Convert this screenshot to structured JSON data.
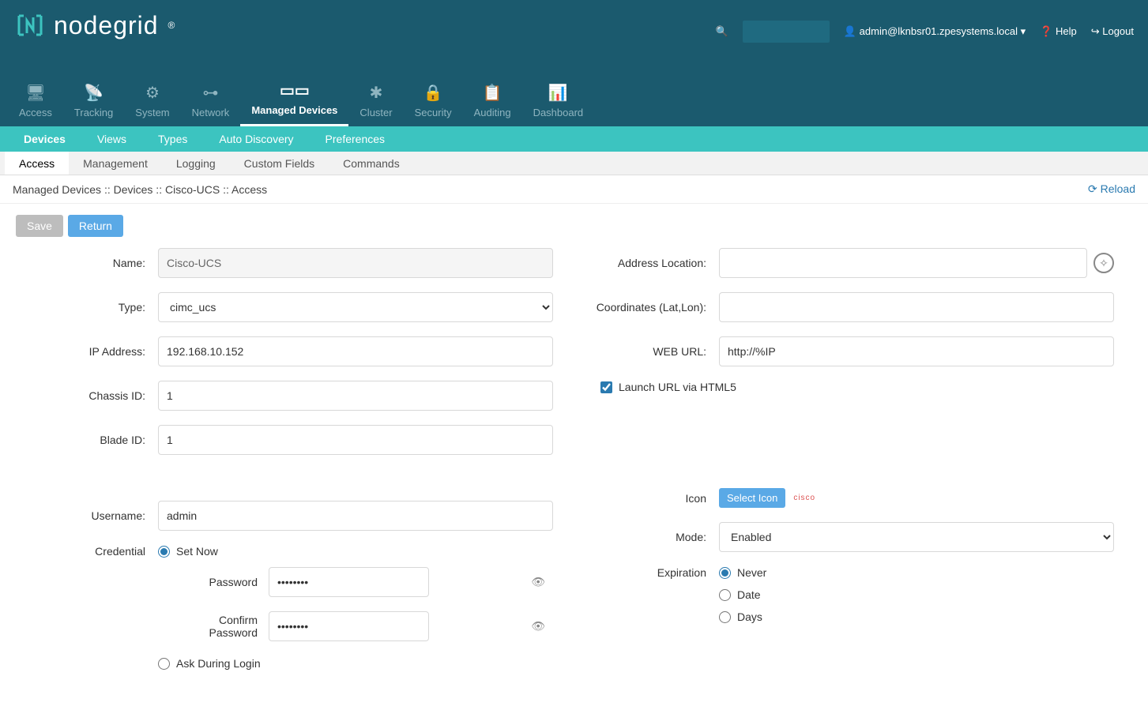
{
  "brand": "nodegrid",
  "user_label": "admin@lknbsr01.zpesystems.local",
  "help_label": "Help",
  "logout_label": "Logout",
  "main_nav": [
    "Access",
    "Tracking",
    "System",
    "Network",
    "Managed Devices",
    "Cluster",
    "Security",
    "Auditing",
    "Dashboard"
  ],
  "sub_nav": [
    "Devices",
    "Views",
    "Types",
    "Auto Discovery",
    "Preferences"
  ],
  "third_nav": [
    "Access",
    "Management",
    "Logging",
    "Custom Fields",
    "Commands"
  ],
  "breadcrumb": "Managed Devices :: Devices :: Cisco-UCS :: Access",
  "reload_label": "Reload",
  "buttons": {
    "save": "Save",
    "return": "Return",
    "select_icon": "Select Icon"
  },
  "labels": {
    "name": "Name:",
    "type": "Type:",
    "ip": "IP Address:",
    "chassis": "Chassis ID:",
    "blade": "Blade ID:",
    "username": "Username:",
    "credential": "Credential",
    "password": "Password",
    "confirm": "Confirm Password",
    "set_now": "Set Now",
    "ask_login": "Ask During Login",
    "addr_loc": "Address Location:",
    "coords": "Coordinates (Lat,Lon):",
    "weburl": "WEB URL:",
    "launch_html5": "Launch URL via HTML5",
    "icon": "Icon",
    "mode": "Mode:",
    "expiration": "Expiration",
    "never": "Never",
    "date": "Date",
    "days": "Days"
  },
  "values": {
    "name": "Cisco-UCS",
    "type": "cimc_ucs",
    "ip": "192.168.10.152",
    "chassis": "1",
    "blade": "1",
    "username": "admin",
    "password": "••••••••",
    "confirm": "••••••••",
    "addr_loc": "",
    "coords": "",
    "weburl": "http://%IP",
    "mode": "Enabled",
    "cisco": "cisco"
  }
}
